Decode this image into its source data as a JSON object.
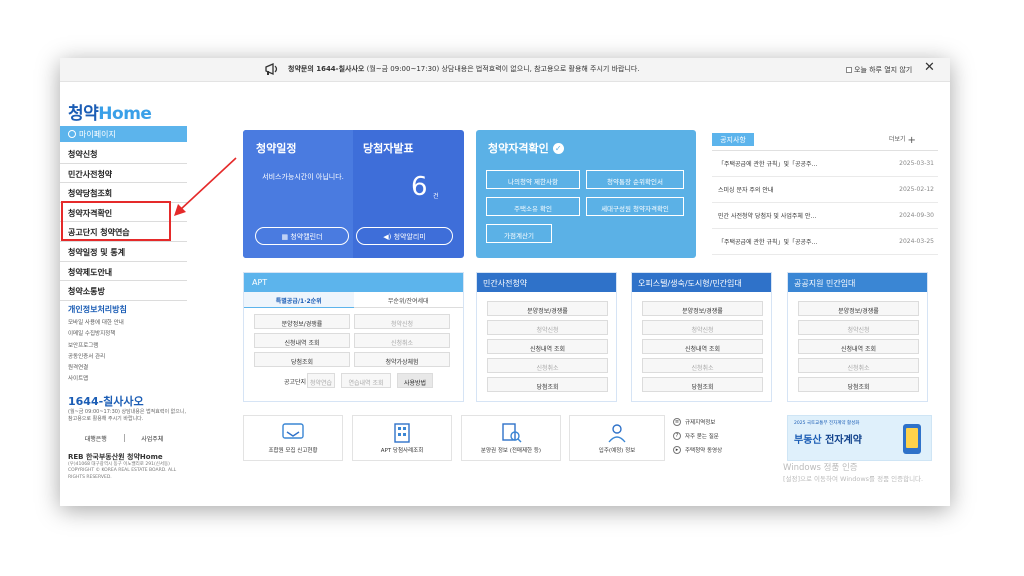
{
  "topbar": {
    "notice_bold": "청약문의 1644-칠사사오",
    "notice_text": "(월~금 09:00~17:30) 상담내용은 법적효력이 없으니, 참고용으로 활용해 주시기 바랍니다.",
    "no_today": "오늘 하루 열지 않기",
    "close": "✕"
  },
  "sidebar": {
    "logo_prefix": "청약",
    "logo_suffix": "Home",
    "mypage": "마이페이지",
    "items": [
      "청약신청",
      "민간사전청약",
      "청약당첨조회",
      "청약자격확인",
      "공고단지 청약연습",
      "청약일정 및 통계",
      "청약제도안내",
      "청약소통방"
    ],
    "privacy": "개인정보처리방침",
    "links": [
      "모바일 사용에 대한 안내",
      "이메일 수집방지정책",
      "보안프로그램",
      "공동인증서 관리",
      "원격연결",
      "사이트맵"
    ],
    "cc_number": "1644-칠사사오",
    "cc_desc": "(월~금 09:00~17:30) 상담내용은 법적효력이 없으니, 참고용으로 활용해 주시기 바랍니다.",
    "bank1": "대행은행",
    "bank2": "사업주체",
    "reb_logo": "REB 한국부동산원 청약Home",
    "reb_small": "(우)41068 대구광역시 동구 이노밸리로 291(신서동) COPYRIGHT © KOREA REAL ESTATE BOARD. ALL RIGHTS RESERVED."
  },
  "card_schedule": {
    "title1": "청약일정",
    "title2": "당첨자발표",
    "message": "서비스가능시간이 아닙니다.",
    "count": "6",
    "unit": "건",
    "btn1": "청약캘린더",
    "btn2": "청약알리미"
  },
  "card_qualify": {
    "title": "청약자격확인",
    "buttons": [
      "나의청약 제한사항",
      "청약통장 순위확인서",
      "주택소유 확인",
      "세대구성원 청약자격확인",
      "가점계산기"
    ]
  },
  "notices": {
    "tab": "공지사항",
    "more": "더보기",
    "rows": [
      {
        "title": "「주택공급에 관한 규칙」및「공공주…",
        "date": "2025-03-31"
      },
      {
        "title": "스미싱 문자 주의 안내",
        "date": "2025-02-12"
      },
      {
        "title": "민간 사전청약 당첨자 및 사업주체 안…",
        "date": "2024-09-30"
      },
      {
        "title": "「주택공급에 관한 규칙」및「공공주…",
        "date": "2024-03-25"
      }
    ]
  },
  "apt": {
    "title": "APT",
    "tab1": "특별공급/1·2순위",
    "tab2": "무순위/잔여세대",
    "b1": "분양정보/경쟁률",
    "b2": "청약신청",
    "b3": "신청내역 조회",
    "b4": "신청취소",
    "b5": "당첨조회",
    "b6": "청약가상체험",
    "label": "공고단지",
    "s1": "청약연습",
    "s2": "연습내역 조회",
    "s3": "사용방법"
  },
  "panels": [
    {
      "title": "민간사전청약",
      "items": [
        "분양정보/경쟁률",
        "청약신청",
        "신청내역 조회",
        "신청취소",
        "당첨조회"
      ]
    },
    {
      "title": "오피스텔/생숙/도시형/민간임대",
      "items": [
        "분양정보/경쟁률",
        "청약신청",
        "신청내역 조회",
        "신청취소",
        "당첨조회"
      ]
    },
    {
      "title": "공공지원 민간임대",
      "items": [
        "분양정보/경쟁률",
        "청약신청",
        "신청내역 조회",
        "신청취소",
        "당첨조회"
      ]
    }
  ],
  "bottom": {
    "i1": "조합원 모집 신고현황",
    "i2": "APT 당첨사례조회",
    "i3": "분양권 정보 (전매제한 등)",
    "i4": "입주(예정) 정보",
    "l1": "규제지역정보",
    "l2": "자주 묻는 질문",
    "l3": "주택청약 동영상",
    "ad_small": "2025 국토교통부 전자계약 활성화",
    "ad_big1": "부동산 ",
    "ad_big2": "전자계약"
  },
  "windows": {
    "line1": "Windows 정품 인증",
    "line2": "[설정]으로 이동하여 Windows를 정품 인증합니다."
  },
  "colors": {
    "accent": "#5cb4ec",
    "brand": "#1b5db5",
    "annotation": "#e52a2a"
  }
}
